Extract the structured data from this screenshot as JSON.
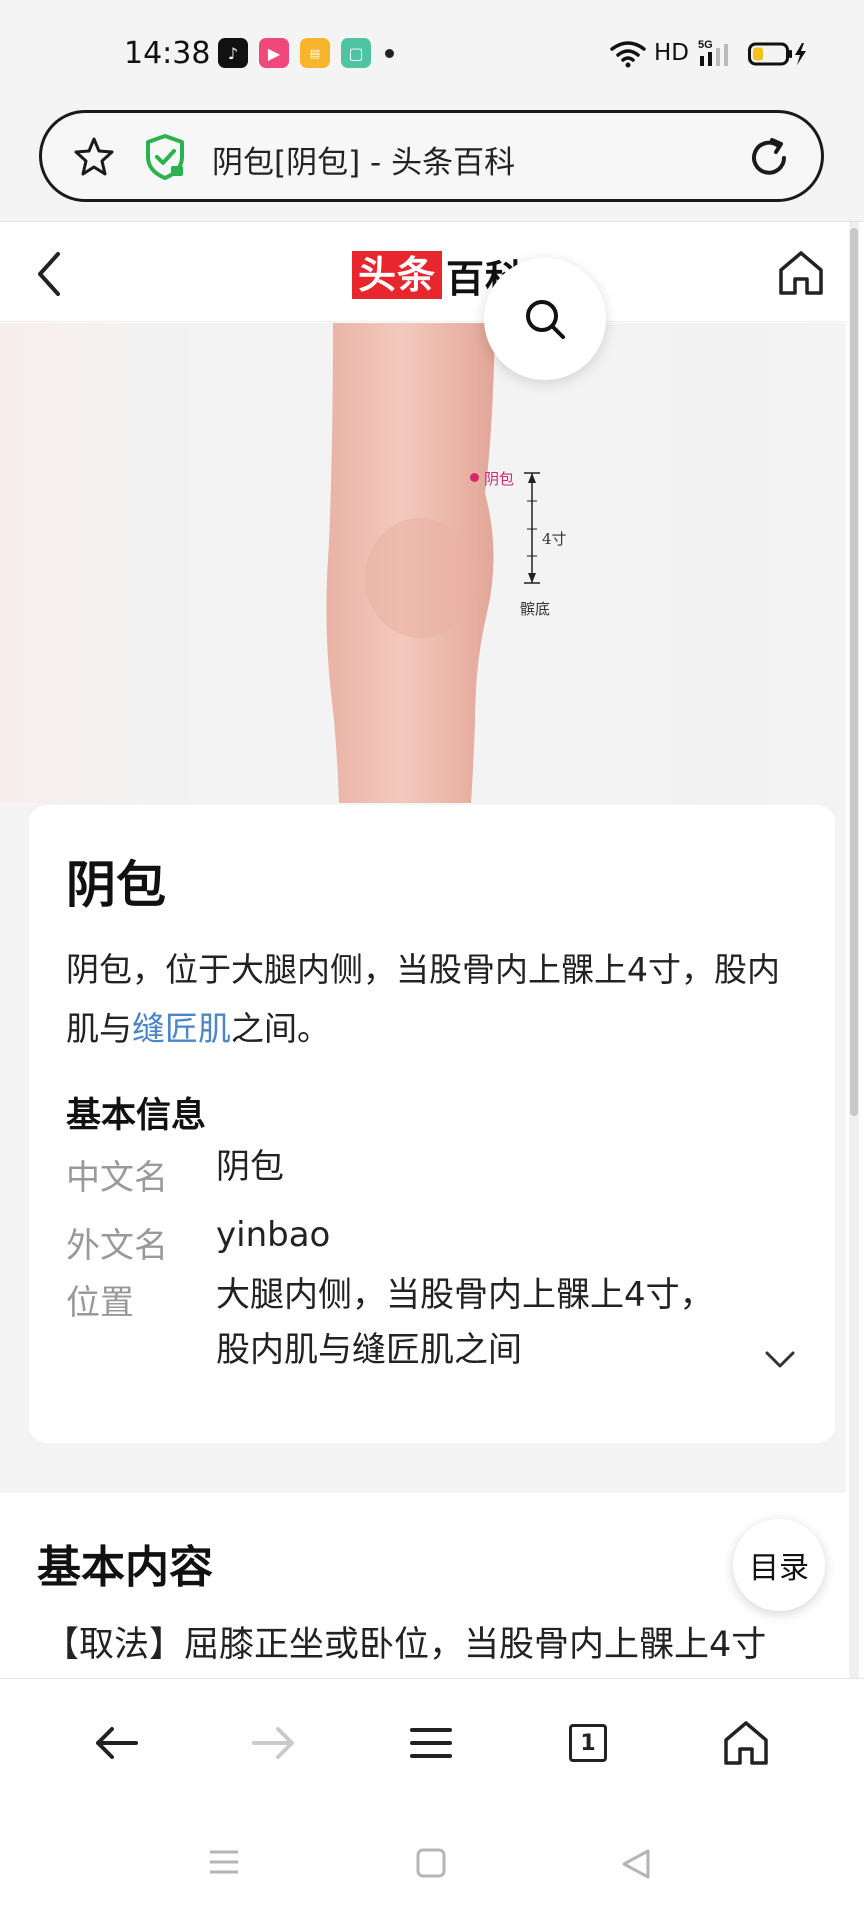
{
  "status_bar": {
    "time": "14:38",
    "network_label": "HD",
    "signal_label": "5G",
    "app_icons": [
      "tiktok-icon",
      "video-app-icon",
      "reader-app-icon",
      "notes-app-icon"
    ]
  },
  "address_bar": {
    "page_title": "阴包[阴包] - 头条百科"
  },
  "site_header": {
    "logo_red": "头条",
    "logo_black": "百科"
  },
  "hero_image": {
    "acupoint_label": "阴包",
    "measure_label": "4寸",
    "reference_label": "髌底"
  },
  "entry": {
    "title": "阴包",
    "summary_before_link": "阴包，位于大腿内侧，当股骨内上髁上4寸，股内肌与",
    "summary_link": "缝匠肌",
    "summary_after_link": "之间。",
    "basic_info_heading": "基本信息",
    "basic_info": [
      {
        "label": "中文名",
        "value": "阴包"
      },
      {
        "label": "外文名",
        "value": "yinbao"
      },
      {
        "label": "位置",
        "value_line1": "大腿内侧，当股骨内上髁上4寸，",
        "value_line2": "股内肌与缝匠肌之间"
      }
    ]
  },
  "content": {
    "heading": "基本内容",
    "first_line": "【取法】屈膝正坐或卧位，当股骨内上髁上4寸"
  },
  "toc_button_label": "目录",
  "toolbar": {
    "tab_count": "1"
  },
  "colors": {
    "logo_red": "#e8262d",
    "link_blue": "#4a86c8",
    "acupoint_magenta": "#d6266e",
    "shield_green": "#2bb24c"
  }
}
